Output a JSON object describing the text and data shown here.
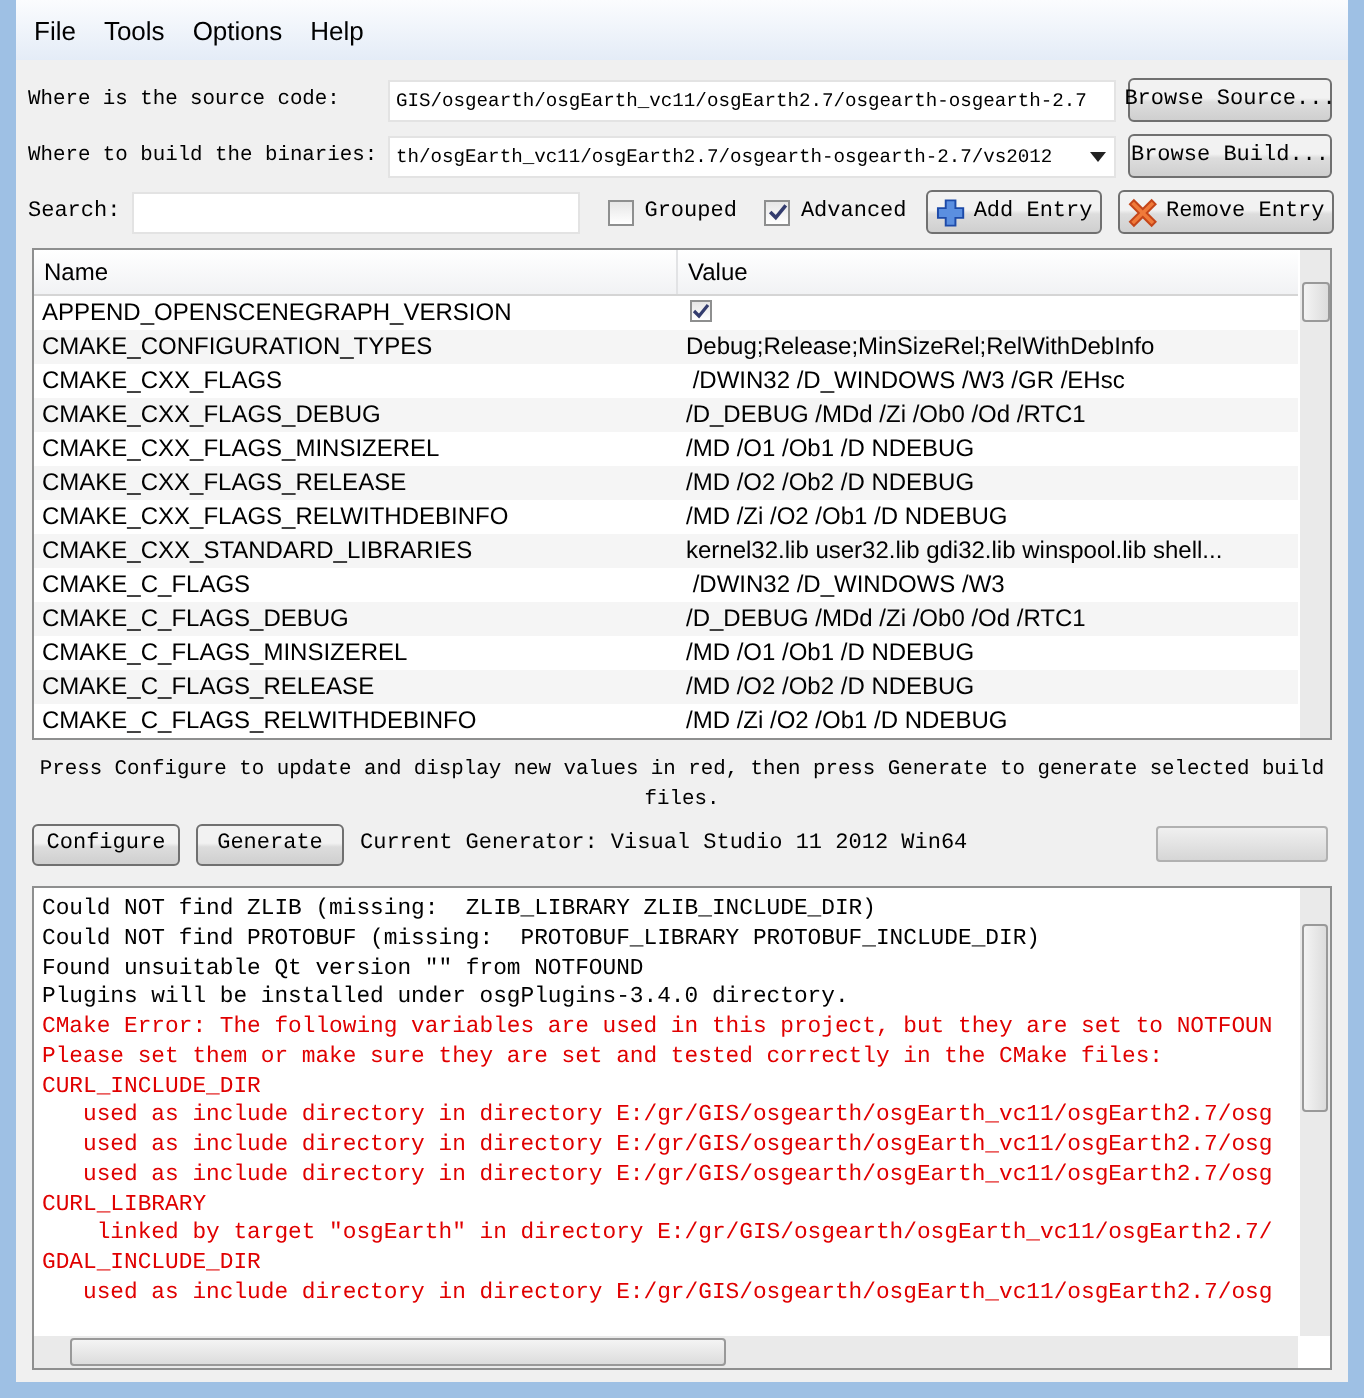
{
  "menu": [
    "File",
    "Tools",
    "Options",
    "Help"
  ],
  "source": {
    "label": "Where is the source code:",
    "value": "GIS/osgearth/osgEarth_vc11/osgEarth2.7/osgearth-osgearth-2.7",
    "button": "Browse Source..."
  },
  "build": {
    "label": "Where to build the binaries:",
    "value": "th/osgEarth_vc11/osgEarth2.7/osgearth-osgearth-2.7/vs2012",
    "button": "Browse Build..."
  },
  "search": {
    "label": "Search:"
  },
  "options": [
    {
      "label": "Grouped",
      "checked": false
    },
    {
      "label": "Advanced",
      "checked": true
    }
  ],
  "entry_buttons": [
    {
      "kind": "add",
      "label": "Add Entry"
    },
    {
      "kind": "remove",
      "label": "Remove Entry"
    }
  ],
  "table": {
    "columns": [
      "Name",
      "Value"
    ],
    "rows": [
      {
        "name": "APPEND_OPENSCENEGRAPH_VERSION",
        "kind": "bool",
        "checked": true
      },
      {
        "name": "CMAKE_CONFIGURATION_TYPES",
        "kind": "text",
        "value": "Debug;Release;MinSizeRel;RelWithDebInfo"
      },
      {
        "name": "CMAKE_CXX_FLAGS",
        "kind": "text",
        "value": " /DWIN32 /D_WINDOWS /W3 /GR /EHsc"
      },
      {
        "name": "CMAKE_CXX_FLAGS_DEBUG",
        "kind": "text",
        "value": "/D_DEBUG /MDd /Zi /Ob0 /Od /RTC1"
      },
      {
        "name": "CMAKE_CXX_FLAGS_MINSIZEREL",
        "kind": "text",
        "value": "/MD /O1 /Ob1 /D NDEBUG"
      },
      {
        "name": "CMAKE_CXX_FLAGS_RELEASE",
        "kind": "text",
        "value": "/MD /O2 /Ob2 /D NDEBUG"
      },
      {
        "name": "CMAKE_CXX_FLAGS_RELWITHDEBINFO",
        "kind": "text",
        "value": "/MD /Zi /O2 /Ob1 /D NDEBUG"
      },
      {
        "name": "CMAKE_CXX_STANDARD_LIBRARIES",
        "kind": "text",
        "value": "kernel32.lib user32.lib gdi32.lib winspool.lib shell..."
      },
      {
        "name": "CMAKE_C_FLAGS",
        "kind": "text",
        "value": " /DWIN32 /D_WINDOWS /W3"
      },
      {
        "name": "CMAKE_C_FLAGS_DEBUG",
        "kind": "text",
        "value": "/D_DEBUG /MDd /Zi /Ob0 /Od /RTC1"
      },
      {
        "name": "CMAKE_C_FLAGS_MINSIZEREL",
        "kind": "text",
        "value": "/MD /O1 /Ob1 /D NDEBUG"
      },
      {
        "name": "CMAKE_C_FLAGS_RELEASE",
        "kind": "text",
        "value": "/MD /O2 /Ob2 /D NDEBUG"
      },
      {
        "name": "CMAKE_C_FLAGS_RELWITHDEBINFO",
        "kind": "text",
        "value": "/MD /Zi /O2 /Ob1 /D NDEBUG"
      }
    ]
  },
  "message": "Press Configure to update and display new values in red, then press Generate to generate selected build files.",
  "actions": [
    "Configure",
    "Generate"
  ],
  "generator": "Current Generator: Visual Studio 11 2012 Win64",
  "progress": {
    "level": 0
  },
  "log": [
    {
      "kind": "info",
      "text": "Could NOT find ZLIB (missing:  ZLIB_LIBRARY ZLIB_INCLUDE_DIR)"
    },
    {
      "kind": "info",
      "text": "Could NOT find PROTOBUF (missing:  PROTOBUF_LIBRARY PROTOBUF_INCLUDE_DIR)"
    },
    {
      "kind": "info",
      "text": "Found unsuitable Qt version \"\" from NOTFOUND"
    },
    {
      "kind": "info",
      "text": "Plugins will be installed under osgPlugins-3.4.0 directory."
    },
    {
      "kind": "error",
      "text": "CMake Error: The following variables are used in this project, but they are set to NOTFOUN"
    },
    {
      "kind": "error",
      "text": "Please set them or make sure they are set and tested correctly in the CMake files:"
    },
    {
      "kind": "error",
      "text": "CURL_INCLUDE_DIR"
    },
    {
      "kind": "error",
      "text": "   used as include directory in directory E:/gr/GIS/osgearth/osgEarth_vc11/osgEarth2.7/osg"
    },
    {
      "kind": "error",
      "text": "   used as include directory in directory E:/gr/GIS/osgearth/osgEarth_vc11/osgEarth2.7/osg"
    },
    {
      "kind": "error",
      "text": "   used as include directory in directory E:/gr/GIS/osgearth/osgEarth_vc11/osgEarth2.7/osg"
    },
    {
      "kind": "error",
      "text": "CURL_LIBRARY"
    },
    {
      "kind": "error",
      "text": "    linked by target \"osgEarth\" in directory E:/gr/GIS/osgearth/osgEarth_vc11/osgEarth2.7/"
    },
    {
      "kind": "error",
      "text": "GDAL_INCLUDE_DIR"
    },
    {
      "kind": "error",
      "text": "   used as include directory in directory E:/gr/GIS/osgearth/osgEarth_vc11/osgEarth2.7/osg"
    }
  ]
}
